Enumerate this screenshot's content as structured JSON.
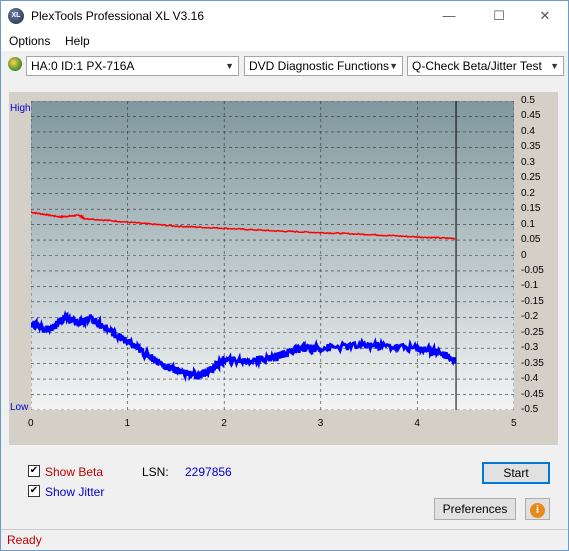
{
  "window": {
    "title": "PlexTools Professional XL V3.16",
    "icon_text": "XL"
  },
  "window_buttons": {
    "minimize": "—",
    "maximize": "☐",
    "close": "✕"
  },
  "menu": {
    "options": "Options",
    "help": "Help"
  },
  "toolbar": {
    "drive": "HA:0 ID:1  PX-716A",
    "function": "DVD Diagnostic Functions",
    "test": "Q-Check Beta/Jitter Test",
    "arrow": "▼"
  },
  "chart_data": {
    "type": "line",
    "left_axis_labels": [
      "High",
      "Low"
    ],
    "y_ticks": [
      "0.5",
      "0.45",
      "0.4",
      "0.35",
      "0.3",
      "0.25",
      "0.2",
      "0.15",
      "0.1",
      "0.05",
      "0",
      "-0.05",
      "-0.1",
      "-0.15",
      "-0.2",
      "-0.25",
      "-0.3",
      "-0.35",
      "-0.4",
      "-0.45",
      "-0.5"
    ],
    "x_ticks": [
      "0",
      "1",
      "2",
      "3",
      "4",
      "5"
    ],
    "xlim": [
      0,
      5
    ],
    "ylim": [
      -0.5,
      0.5
    ],
    "grid": true,
    "end_marker_x": 4.4,
    "series": [
      {
        "color": "#ff0000",
        "x": [
          0,
          0.3,
          0.5,
          0.55,
          1.0,
          1.5,
          2.0,
          2.5,
          3.0,
          3.5,
          4.0,
          4.4
        ],
        "y": [
          0.14,
          0.125,
          0.13,
          0.12,
          0.108,
          0.095,
          0.088,
          0.08,
          0.074,
          0.068,
          0.06,
          0.055
        ]
      },
      {
        "color": "#0000ff",
        "x": [
          0,
          0.2,
          0.35,
          0.5,
          0.6,
          0.8,
          1.0,
          1.2,
          1.4,
          1.6,
          1.75,
          1.9,
          2.0,
          2.3,
          2.5,
          2.6,
          2.8,
          3.0,
          3.5,
          4.0,
          4.2,
          4.4
        ],
        "y": [
          -0.22,
          -0.24,
          -0.2,
          -0.22,
          -0.2,
          -0.24,
          -0.28,
          -0.32,
          -0.36,
          -0.38,
          -0.39,
          -0.36,
          -0.34,
          -0.34,
          -0.33,
          -0.32,
          -0.3,
          -0.3,
          -0.29,
          -0.3,
          -0.31,
          -0.34
        ]
      }
    ]
  },
  "controls": {
    "show_beta": "Show Beta",
    "show_beta_checked": true,
    "show_jitter": "Show Jitter",
    "show_jitter_checked": true,
    "lsn_label": "LSN:",
    "lsn_value": "2297856",
    "start": "Start",
    "preferences": "Preferences",
    "check_mark": "✔",
    "info_icon_text": "i"
  },
  "status": {
    "text": "Ready"
  },
  "colors": {
    "beta": "#c00000",
    "jitter": "#0000cc",
    "status_text": "#c00000"
  }
}
